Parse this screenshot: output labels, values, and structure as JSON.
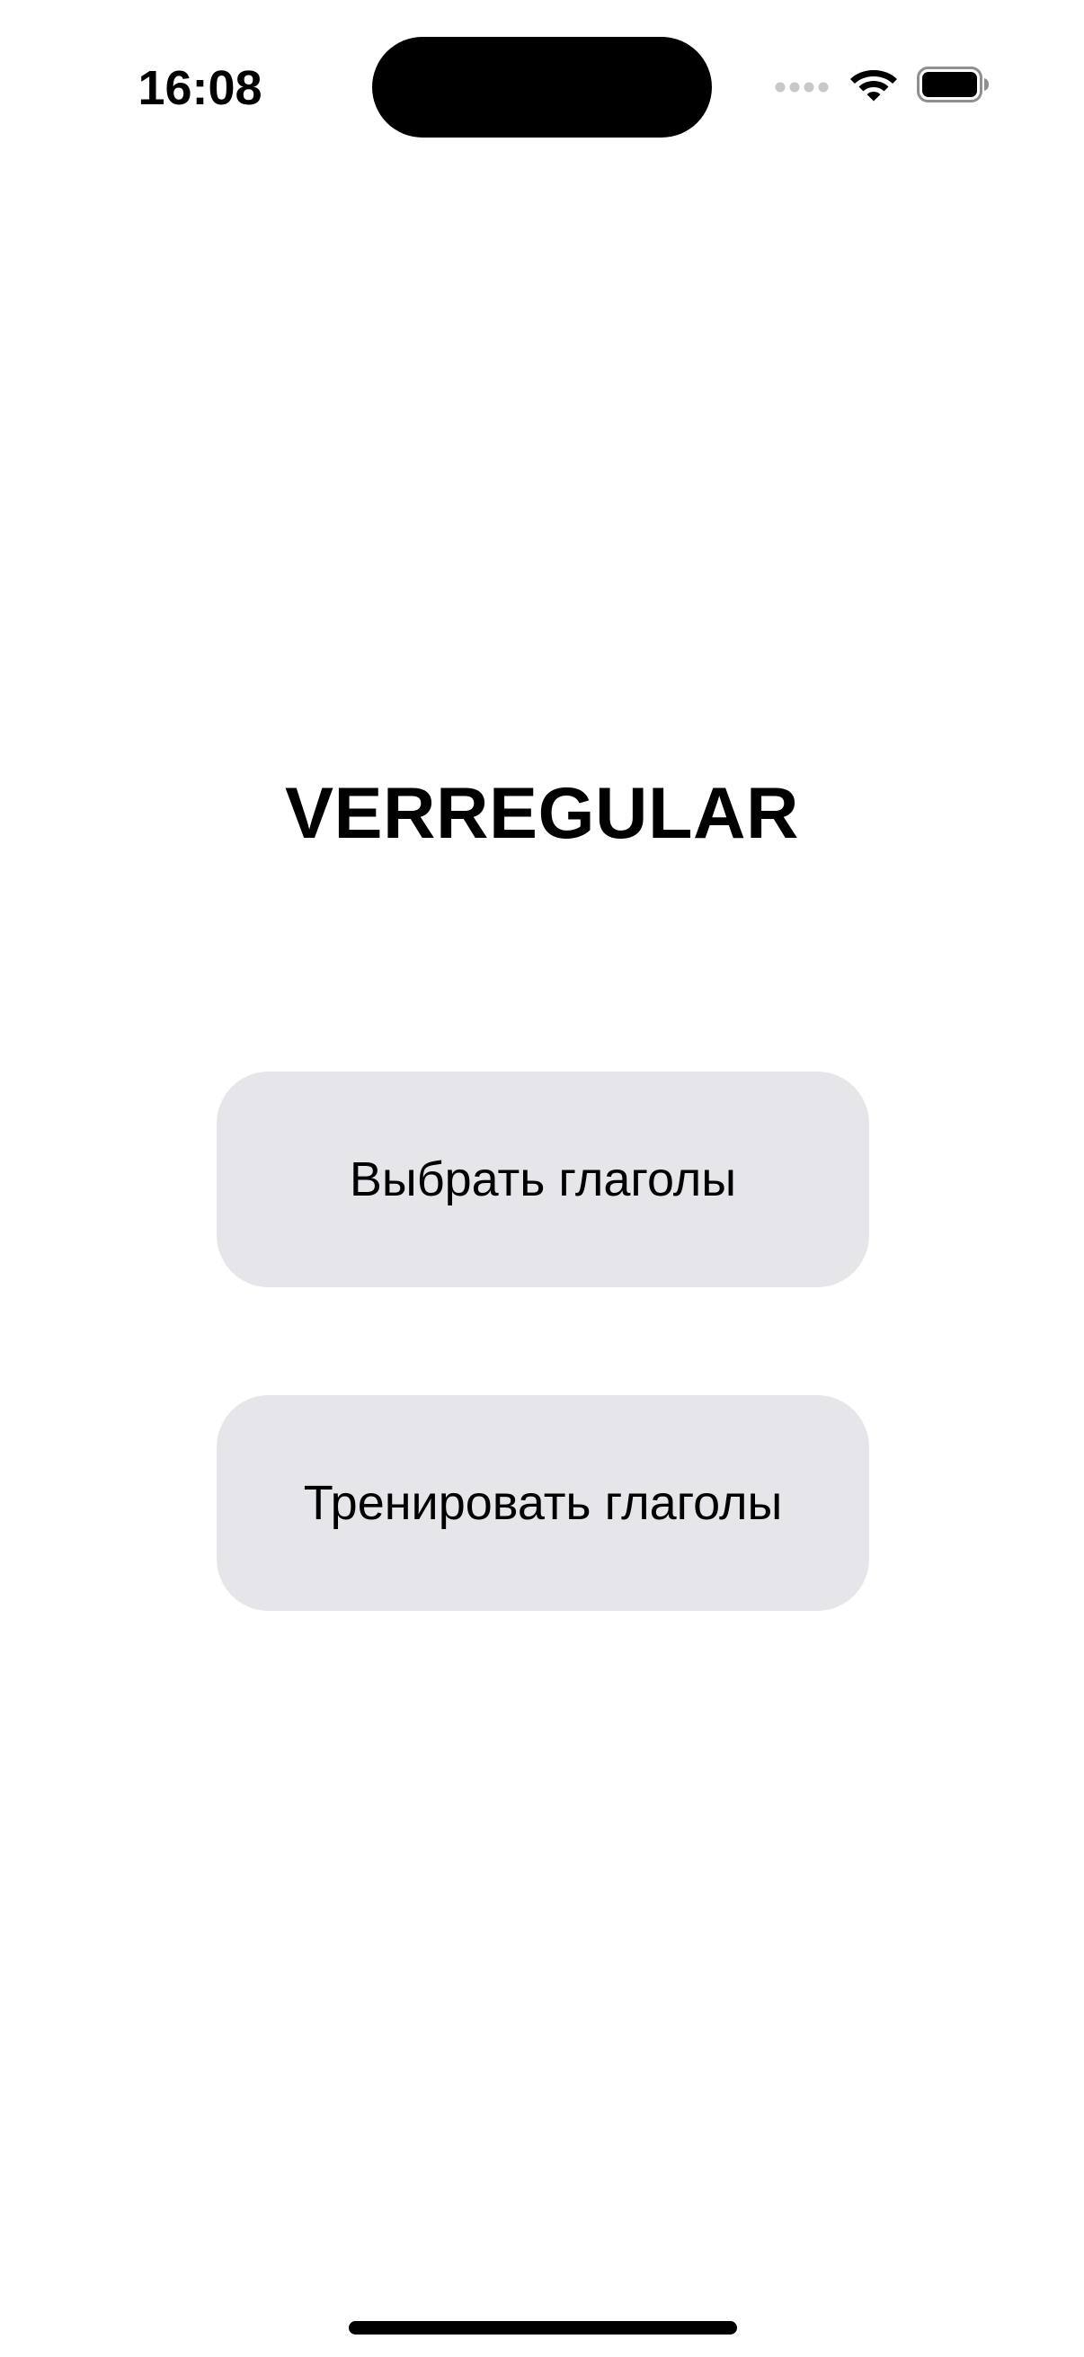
{
  "status_bar": {
    "time": "16:08",
    "icons": {
      "signal": "cellular-signal-icon",
      "wifi": "wifi-icon",
      "battery": "battery-icon"
    },
    "battery_level": 1.0
  },
  "main": {
    "title": "VERREGULAR",
    "buttons": [
      {
        "label": "Выбрать глаголы"
      },
      {
        "label": "Тренировать глаголы"
      }
    ]
  },
  "colors": {
    "background": "#ffffff",
    "button_fill": "#e5e5ea",
    "text": "#000000",
    "signal_inactive": "#c7c7cc"
  }
}
